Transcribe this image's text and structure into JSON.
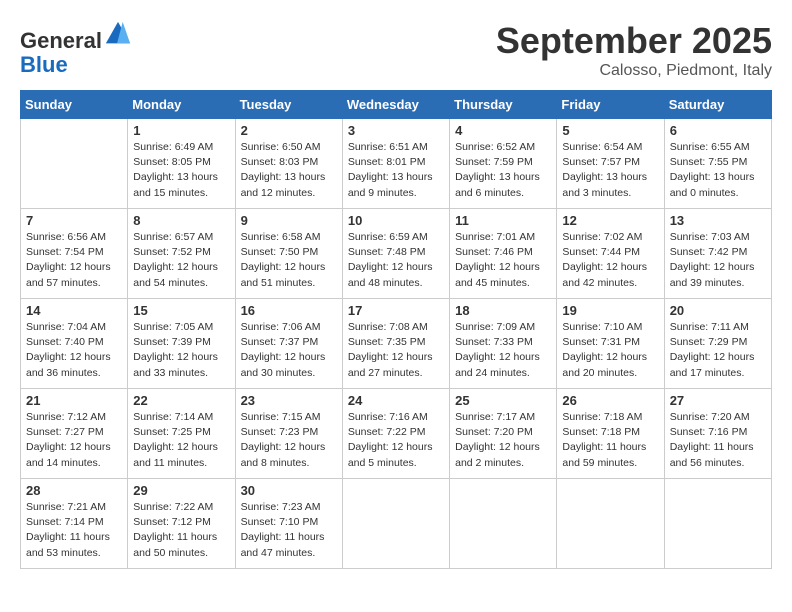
{
  "header": {
    "logo_line1": "General",
    "logo_line2": "Blue",
    "month": "September 2025",
    "location": "Calosso, Piedmont, Italy"
  },
  "days_of_week": [
    "Sunday",
    "Monday",
    "Tuesday",
    "Wednesday",
    "Thursday",
    "Friday",
    "Saturday"
  ],
  "weeks": [
    [
      {
        "day": "",
        "info": ""
      },
      {
        "day": "1",
        "info": "Sunrise: 6:49 AM\nSunset: 8:05 PM\nDaylight: 13 hours\nand 15 minutes."
      },
      {
        "day": "2",
        "info": "Sunrise: 6:50 AM\nSunset: 8:03 PM\nDaylight: 13 hours\nand 12 minutes."
      },
      {
        "day": "3",
        "info": "Sunrise: 6:51 AM\nSunset: 8:01 PM\nDaylight: 13 hours\nand 9 minutes."
      },
      {
        "day": "4",
        "info": "Sunrise: 6:52 AM\nSunset: 7:59 PM\nDaylight: 13 hours\nand 6 minutes."
      },
      {
        "day": "5",
        "info": "Sunrise: 6:54 AM\nSunset: 7:57 PM\nDaylight: 13 hours\nand 3 minutes."
      },
      {
        "day": "6",
        "info": "Sunrise: 6:55 AM\nSunset: 7:55 PM\nDaylight: 13 hours\nand 0 minutes."
      }
    ],
    [
      {
        "day": "7",
        "info": "Sunrise: 6:56 AM\nSunset: 7:54 PM\nDaylight: 12 hours\nand 57 minutes."
      },
      {
        "day": "8",
        "info": "Sunrise: 6:57 AM\nSunset: 7:52 PM\nDaylight: 12 hours\nand 54 minutes."
      },
      {
        "day": "9",
        "info": "Sunrise: 6:58 AM\nSunset: 7:50 PM\nDaylight: 12 hours\nand 51 minutes."
      },
      {
        "day": "10",
        "info": "Sunrise: 6:59 AM\nSunset: 7:48 PM\nDaylight: 12 hours\nand 48 minutes."
      },
      {
        "day": "11",
        "info": "Sunrise: 7:01 AM\nSunset: 7:46 PM\nDaylight: 12 hours\nand 45 minutes."
      },
      {
        "day": "12",
        "info": "Sunrise: 7:02 AM\nSunset: 7:44 PM\nDaylight: 12 hours\nand 42 minutes."
      },
      {
        "day": "13",
        "info": "Sunrise: 7:03 AM\nSunset: 7:42 PM\nDaylight: 12 hours\nand 39 minutes."
      }
    ],
    [
      {
        "day": "14",
        "info": "Sunrise: 7:04 AM\nSunset: 7:40 PM\nDaylight: 12 hours\nand 36 minutes."
      },
      {
        "day": "15",
        "info": "Sunrise: 7:05 AM\nSunset: 7:39 PM\nDaylight: 12 hours\nand 33 minutes."
      },
      {
        "day": "16",
        "info": "Sunrise: 7:06 AM\nSunset: 7:37 PM\nDaylight: 12 hours\nand 30 minutes."
      },
      {
        "day": "17",
        "info": "Sunrise: 7:08 AM\nSunset: 7:35 PM\nDaylight: 12 hours\nand 27 minutes."
      },
      {
        "day": "18",
        "info": "Sunrise: 7:09 AM\nSunset: 7:33 PM\nDaylight: 12 hours\nand 24 minutes."
      },
      {
        "day": "19",
        "info": "Sunrise: 7:10 AM\nSunset: 7:31 PM\nDaylight: 12 hours\nand 20 minutes."
      },
      {
        "day": "20",
        "info": "Sunrise: 7:11 AM\nSunset: 7:29 PM\nDaylight: 12 hours\nand 17 minutes."
      }
    ],
    [
      {
        "day": "21",
        "info": "Sunrise: 7:12 AM\nSunset: 7:27 PM\nDaylight: 12 hours\nand 14 minutes."
      },
      {
        "day": "22",
        "info": "Sunrise: 7:14 AM\nSunset: 7:25 PM\nDaylight: 12 hours\nand 11 minutes."
      },
      {
        "day": "23",
        "info": "Sunrise: 7:15 AM\nSunset: 7:23 PM\nDaylight: 12 hours\nand 8 minutes."
      },
      {
        "day": "24",
        "info": "Sunrise: 7:16 AM\nSunset: 7:22 PM\nDaylight: 12 hours\nand 5 minutes."
      },
      {
        "day": "25",
        "info": "Sunrise: 7:17 AM\nSunset: 7:20 PM\nDaylight: 12 hours\nand 2 minutes."
      },
      {
        "day": "26",
        "info": "Sunrise: 7:18 AM\nSunset: 7:18 PM\nDaylight: 11 hours\nand 59 minutes."
      },
      {
        "day": "27",
        "info": "Sunrise: 7:20 AM\nSunset: 7:16 PM\nDaylight: 11 hours\nand 56 minutes."
      }
    ],
    [
      {
        "day": "28",
        "info": "Sunrise: 7:21 AM\nSunset: 7:14 PM\nDaylight: 11 hours\nand 53 minutes."
      },
      {
        "day": "29",
        "info": "Sunrise: 7:22 AM\nSunset: 7:12 PM\nDaylight: 11 hours\nand 50 minutes."
      },
      {
        "day": "30",
        "info": "Sunrise: 7:23 AM\nSunset: 7:10 PM\nDaylight: 11 hours\nand 47 minutes."
      },
      {
        "day": "",
        "info": ""
      },
      {
        "day": "",
        "info": ""
      },
      {
        "day": "",
        "info": ""
      },
      {
        "day": "",
        "info": ""
      }
    ]
  ]
}
